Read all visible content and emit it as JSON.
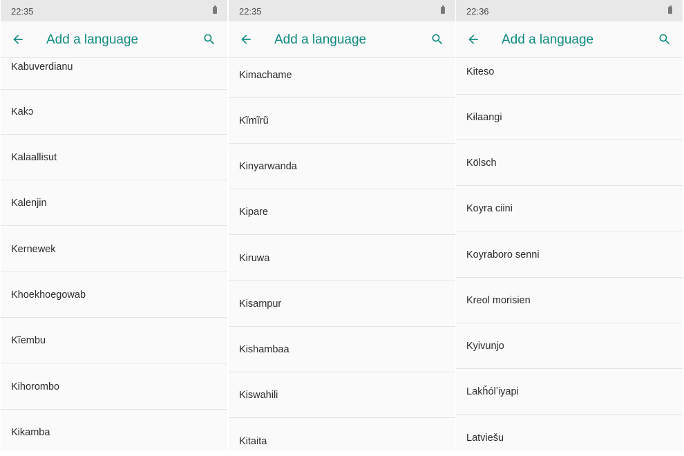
{
  "panels": [
    {
      "status_time": "22:35",
      "title": "Add a language",
      "languages": [
        "Kabuverdianu",
        "Kakɔ",
        "Kalaallisut",
        "Kalenjin",
        "Kernewek",
        "Khoekhoegowab",
        "Kĩembu",
        "Kihorombo",
        "Kikamba"
      ]
    },
    {
      "status_time": "22:35",
      "title": "Add a language",
      "languages": [
        "Kimachame",
        "Kĩmĩrũ",
        "Kinyarwanda",
        "Kipare",
        "Kiruwa",
        "Kisampur",
        "Kishambaa",
        "Kiswahili",
        "Kitaita"
      ]
    },
    {
      "status_time": "22:36",
      "title": "Add a language",
      "languages": [
        "Kiteso",
        "Kɨlaangi",
        "Kölsch",
        "Koyra ciini",
        "Koyraboro senni",
        "Kreol morisien",
        "Kyivunjo",
        "Lakȟólʼiyapi",
        "Latviešu"
      ]
    }
  ],
  "icons": {
    "back": "arrow-back-icon",
    "search": "search-icon",
    "battery": "battery-icon"
  },
  "colors": {
    "accent": "#0d8a80",
    "status_bar": "#e8e8e8",
    "background": "#fafafa",
    "divider": "#e4e4e4"
  }
}
